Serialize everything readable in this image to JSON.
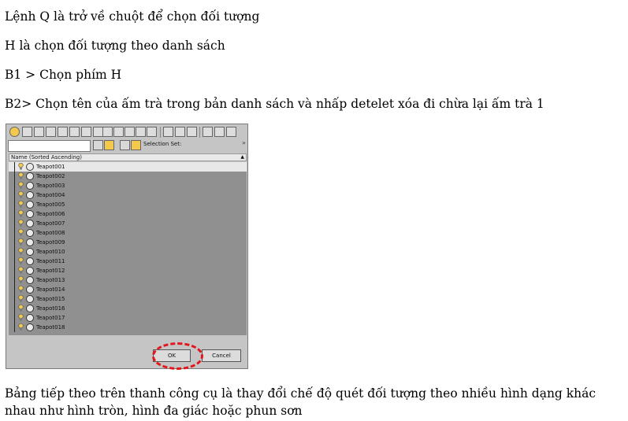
{
  "doc": {
    "line1": "Lệnh Q là trở về chuột để chọn đối tượng",
    "line2": "H là chọn đối tượng theo danh sách",
    "line3": "B1 > Chọn phím H",
    "line4": "B2> Chọn tên của ấm trà trong bản danh sách và nhấp detelet xóa đi chừa lại ấm trà 1",
    "line5": "Bảng tiếp theo trên thanh công cụ là thay đổi chế độ quét đối tượng theo nhiều hình dạng khác nhau như hình tròn, hình đa giác hoặc phun sơn"
  },
  "dialog": {
    "selection_set_label": "Selection Set:",
    "column_header": "Name (Sorted Ascending)",
    "items": [
      "Teapot001",
      "Teapot002",
      "Teapot003",
      "Teapot004",
      "Teapot005",
      "Teapot006",
      "Teapot007",
      "Teapot008",
      "Teapot009",
      "Teapot010",
      "Teapot011",
      "Teapot012",
      "Teapot013",
      "Teapot014",
      "Teapot015",
      "Teapot016",
      "Teapot017",
      "Teapot018"
    ],
    "ok_label": "OK",
    "cancel_label": "Cancel",
    "accent_color": "#e3151a"
  }
}
